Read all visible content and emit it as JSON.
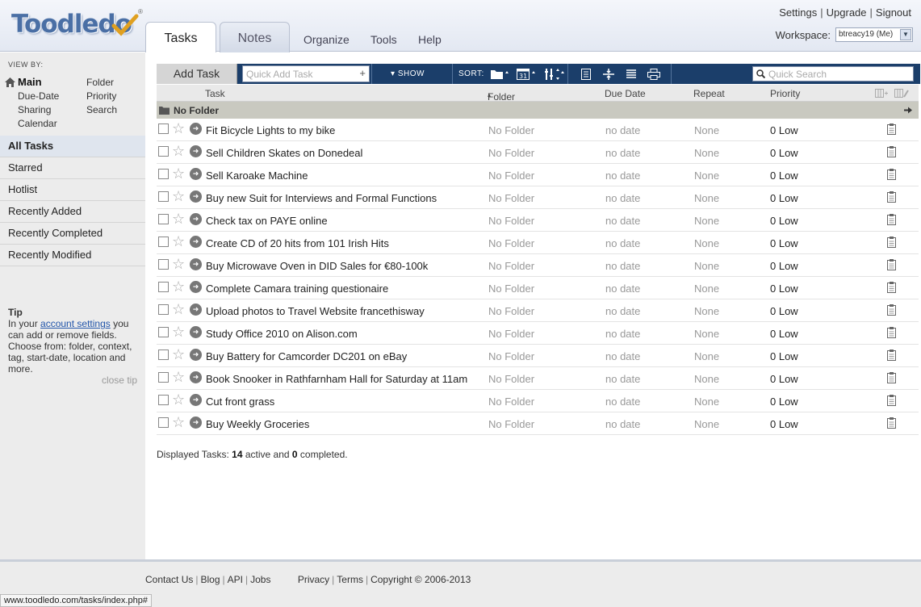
{
  "app": {
    "logo": "Toodledo",
    "reg_mark": "®"
  },
  "header": {
    "tabs": [
      {
        "label": "Tasks"
      },
      {
        "label": "Notes"
      }
    ],
    "nav": [
      {
        "label": "Organize"
      },
      {
        "label": "Tools"
      },
      {
        "label": "Help"
      }
    ],
    "links": {
      "settings": "Settings",
      "upgrade": "Upgrade",
      "signout": "Signout"
    },
    "workspace": {
      "label": "Workspace:",
      "value": "btreacy19 (Me)"
    }
  },
  "sidebar": {
    "view_by_label": "VIEW BY:",
    "view_by": {
      "main": "Main",
      "due_date": "Due-Date",
      "sharing": "Sharing",
      "calendar": "Calendar",
      "folder": "Folder",
      "priority": "Priority",
      "search": "Search"
    },
    "items": [
      {
        "label": "All Tasks"
      },
      {
        "label": "Starred"
      },
      {
        "label": "Hotlist"
      },
      {
        "label": "Recently Added"
      },
      {
        "label": "Recently Completed"
      },
      {
        "label": "Recently Modified"
      }
    ],
    "tip": {
      "title": "Tip",
      "pre": "In your ",
      "link": "account settings",
      "post": " you can add or remove fields. Choose from: folder, context, tag, start-date, location and more.",
      "close": "close tip"
    }
  },
  "toolbar": {
    "add_task": "Add Task",
    "quick_add_placeholder": "Quick Add Task",
    "show": "SHOW",
    "sort": "SORT:",
    "quick_search_placeholder": "Quick Search"
  },
  "columns": {
    "task": "Task",
    "folder": "Folder",
    "due_date": "Due Date",
    "repeat": "Repeat",
    "priority": "Priority"
  },
  "folder_group": "No Folder",
  "tasks": [
    {
      "title": "Fit Bicycle Lights to my bike",
      "folder": "No Folder",
      "due": "no date",
      "repeat": "None",
      "priority": "0 Low"
    },
    {
      "title": "Sell Children Skates on Donedeal",
      "folder": "No Folder",
      "due": "no date",
      "repeat": "None",
      "priority": "0 Low"
    },
    {
      "title": "Sell Karoake Machine",
      "folder": "No Folder",
      "due": "no date",
      "repeat": "None",
      "priority": "0 Low"
    },
    {
      "title": "Buy new Suit for Interviews and Formal Functions",
      "folder": "No Folder",
      "due": "no date",
      "repeat": "None",
      "priority": "0 Low"
    },
    {
      "title": "Check tax on PAYE online",
      "folder": "No Folder",
      "due": "no date",
      "repeat": "None",
      "priority": "0 Low"
    },
    {
      "title": "Create CD of 20 hits from 101 Irish Hits",
      "folder": "No Folder",
      "due": "no date",
      "repeat": "None",
      "priority": "0 Low"
    },
    {
      "title": "Buy Microwave Oven in DID Sales for €80-100k",
      "folder": "No Folder",
      "due": "no date",
      "repeat": "None",
      "priority": "0 Low"
    },
    {
      "title": "Complete Camara training questionaire",
      "folder": "No Folder",
      "due": "no date",
      "repeat": "None",
      "priority": "0 Low"
    },
    {
      "title": "Upload photos to Travel Website francethisway",
      "folder": "No Folder",
      "due": "no date",
      "repeat": "None",
      "priority": "0 Low"
    },
    {
      "title": "Study Office 2010 on Alison.com",
      "folder": "No Folder",
      "due": "no date",
      "repeat": "None",
      "priority": "0 Low"
    },
    {
      "title": "Buy Battery for Camcorder DC201 on eBay",
      "folder": "No Folder",
      "due": "no date",
      "repeat": "None",
      "priority": "0 Low"
    },
    {
      "title": "Book Snooker in Rathfarnham Hall for Saturday at 11am",
      "folder": "No Folder",
      "due": "no date",
      "repeat": "None",
      "priority": "0 Low"
    },
    {
      "title": "Cut front grass",
      "folder": "No Folder",
      "due": "no date",
      "repeat": "None",
      "priority": "0 Low"
    },
    {
      "title": "Buy Weekly Groceries",
      "folder": "No Folder",
      "due": "no date",
      "repeat": "None",
      "priority": "0 Low"
    }
  ],
  "summary": {
    "prefix": "Displayed Tasks: ",
    "active_count": "14",
    "middle": " active and ",
    "completed_count": "0",
    "suffix": " completed."
  },
  "footer": {
    "links": [
      "Contact Us",
      "Blog",
      "API",
      "Jobs"
    ],
    "legal": [
      "Privacy",
      "Terms"
    ],
    "copyright": "Copyright © 2006-2013"
  },
  "status_bar": "www.toodledo.com/tasks/index.php#",
  "colors": {
    "toolbar_bg": "#1b3e6a",
    "logo_blue": "#4a6fa5",
    "check_gold": "#e0a020"
  },
  "icons": [
    "home-icon",
    "folder-icon",
    "sort-folder-icon",
    "sort-date-icon",
    "sort-priority-icon",
    "list-view-icon",
    "split-view-icon",
    "detail-view-icon",
    "print-icon",
    "search-icon",
    "star-icon",
    "go-arrow-icon",
    "note-icon",
    "arrow-right-icon",
    "column-add-icon",
    "column-edit-icon"
  ]
}
